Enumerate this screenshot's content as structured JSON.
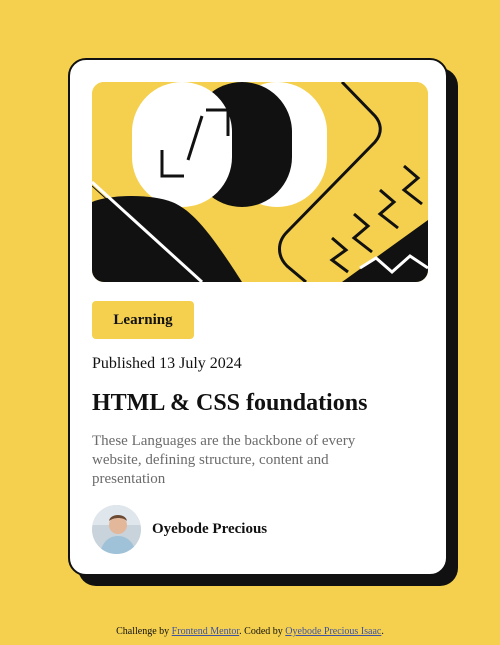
{
  "card": {
    "category": "Learning",
    "published": "Published 13 July 2024",
    "title": "HTML & CSS foundations",
    "description": "These Languages are the backbone of every website, defining structure, content and presentation",
    "author": {
      "name": "Oyebode Precious"
    },
    "hero_illustration_icon": "abstract-shapes-illustration"
  },
  "attribution": {
    "prefix": "Challenge by",
    "challenge_link": "Frontend Mentor",
    "middle": ". Coded by",
    "author_link": "Oyebode Precious Isaac",
    "suffix": "."
  },
  "colors": {
    "background": "#f4d04e",
    "card": "#ffffff",
    "ink": "#111111",
    "muted_text": "#6b6b6b",
    "link": "#3e52a3"
  }
}
